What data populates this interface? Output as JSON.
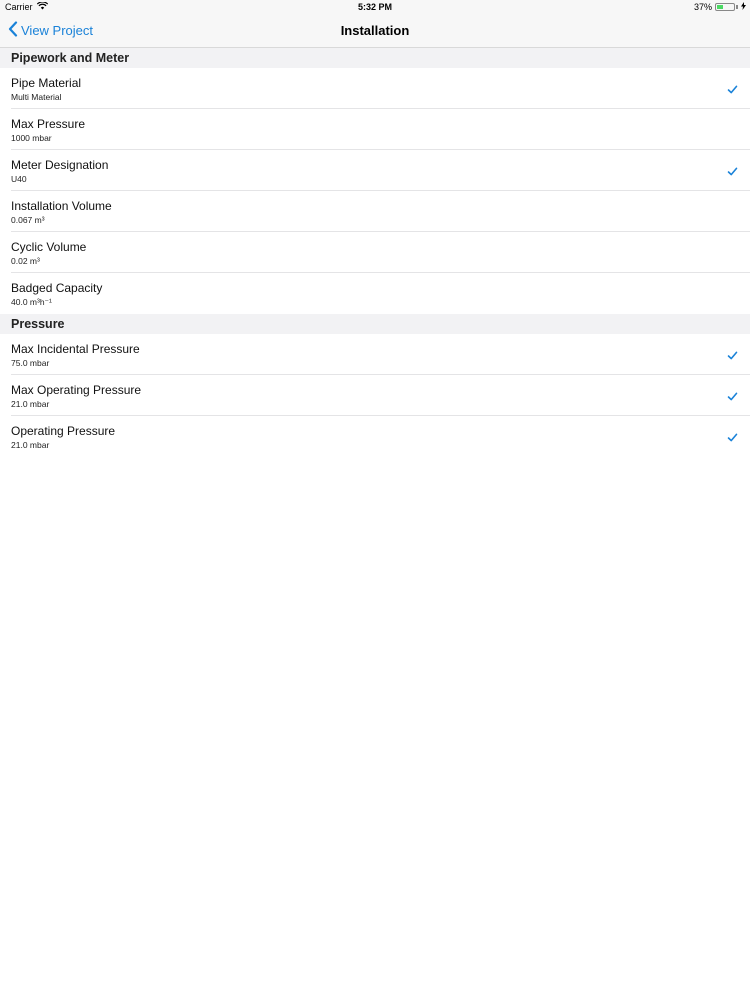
{
  "status_bar": {
    "carrier": "Carrier",
    "time": "5:32 PM",
    "battery_percent": "37%",
    "battery_level": 0.37,
    "icons": [
      "wifi-icon",
      "battery-icon",
      "charging-icon"
    ]
  },
  "nav": {
    "back_label": "View Project",
    "title": "Installation",
    "accent_color": "#1a82d8"
  },
  "sections": [
    {
      "header": "Pipework and Meter",
      "rows": [
        {
          "title": "Pipe Material",
          "value": "Multi Material",
          "checked": true
        },
        {
          "title": "Max Pressure",
          "value": "1000 mbar",
          "checked": false
        },
        {
          "title": "Meter Designation",
          "value": "U40",
          "checked": true
        },
        {
          "title": "Installation Volume",
          "value": "0.067 m³",
          "checked": false
        },
        {
          "title": "Cyclic Volume",
          "value": "0.02 m³",
          "checked": false
        },
        {
          "title": "Badged Capacity",
          "value": "40.0 m³h⁻¹",
          "checked": false
        }
      ]
    },
    {
      "header": "Pressure",
      "rows": [
        {
          "title": "Max Incidental Pressure",
          "value": "75.0 mbar",
          "checked": true
        },
        {
          "title": "Max Operating Pressure",
          "value": "21.0 mbar",
          "checked": true
        },
        {
          "title": "Operating Pressure",
          "value": "21.0 mbar",
          "checked": true
        }
      ]
    }
  ]
}
